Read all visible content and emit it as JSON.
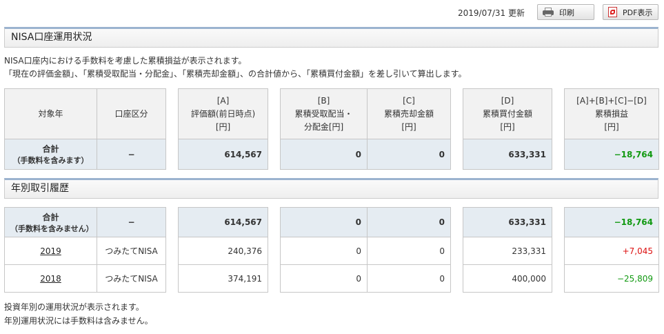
{
  "header": {
    "update_date": "2019/07/31 更新",
    "print_label": "印刷",
    "pdf_label": "PDF表示"
  },
  "account_status": {
    "title": "NISA口座運用状況",
    "note_lines": [
      "NISA口座内における手数料を考慮した累積損益が表示されます。",
      "「現在の評価金額」、「累積受取配当・分配金」、「累積売却金額」、の合計値から、「累積買付金額」を差し引いて算出します。"
    ],
    "columns": {
      "year": "対象年",
      "account_type": "口座区分",
      "a": [
        "[A]",
        "評価額(前日時点)",
        "[円]"
      ],
      "b": [
        "[B]",
        "累積受取配当・",
        "分配金[円]"
      ],
      "c": [
        "[C]",
        "累積売却金額",
        "[円]"
      ],
      "d": [
        "[D]",
        "累積買付金額",
        "[円]"
      ],
      "total": [
        "[A]+[B]+[C]−[D]",
        "累積損益",
        "[円]"
      ]
    },
    "total_row": {
      "label": "合計",
      "sublabel": "（手数料を含みます）",
      "account_type": "−",
      "a": "614,567",
      "b": "0",
      "c": "0",
      "d": "633,331",
      "pl": "−18,764"
    }
  },
  "yearly_history": {
    "title": "年別取引履歴",
    "total_row": {
      "label": "合計",
      "sublabel": "（手数料を含みません）",
      "account_type": "−",
      "a": "614,567",
      "b": "0",
      "c": "0",
      "d": "633,331",
      "pl": "−18,764"
    },
    "rows": [
      {
        "year": "2019",
        "account_type": "つみたてNISA",
        "a": "240,376",
        "b": "0",
        "c": "0",
        "d": "233,331",
        "pl": "+7,045"
      },
      {
        "year": "2018",
        "account_type": "つみたてNISA",
        "a": "374,191",
        "b": "0",
        "c": "0",
        "d": "400,000",
        "pl": "−25,809"
      }
    ],
    "note_lines": [
      "投資年別の運用状況が表示されます。",
      "年別運用状況には手数料は含みません。"
    ]
  },
  "colors": {
    "positive": "#dd1111",
    "negative": "#119911",
    "total_row_bg": "#e5ecf2",
    "header_bg": "#f2f2f2"
  }
}
